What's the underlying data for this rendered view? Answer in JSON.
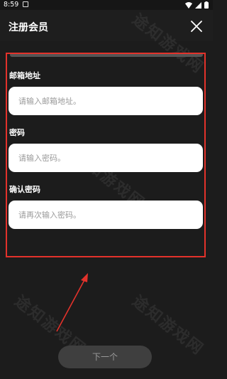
{
  "status_bar": {
    "time": "8:59"
  },
  "header": {
    "title": "注册会员"
  },
  "form": {
    "email": {
      "label": "邮箱地址",
      "placeholder": "请输入邮箱地址。"
    },
    "password": {
      "label": "密码",
      "placeholder": "请输入密码。"
    },
    "confirm_password": {
      "label": "确认密码",
      "placeholder": "请再次输入密码。"
    }
  },
  "next_button": {
    "label": "下一个"
  },
  "watermark": {
    "text": "途知游戏网"
  },
  "colors": {
    "annotation_red": "#e3322b",
    "background": "#1c1c1c",
    "input_background": "#ffffff",
    "button_disabled": "#3f3f3f"
  },
  "icons": {
    "status": [
      "notification-icon",
      "wifi-icon",
      "signal-icon",
      "battery-icon"
    ],
    "close": "close-icon"
  }
}
